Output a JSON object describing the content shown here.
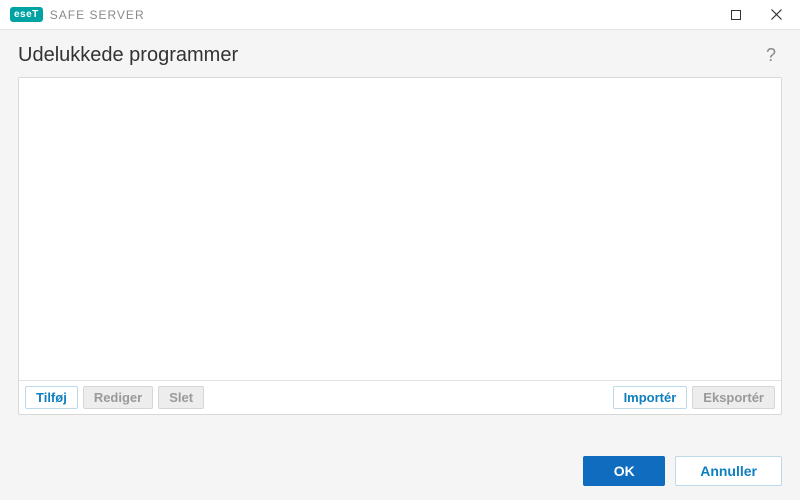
{
  "titlebar": {
    "brand_badge": "eseT",
    "brand_text": "SAFE SERVER"
  },
  "header": {
    "title": "Udelukkede programmer"
  },
  "toolbar": {
    "add": "Tilføj",
    "edit": "Rediger",
    "delete": "Slet",
    "import": "Importér",
    "export": "Eksportér"
  },
  "list": {
    "items": []
  },
  "footer": {
    "ok": "OK",
    "cancel": "Annuller"
  }
}
